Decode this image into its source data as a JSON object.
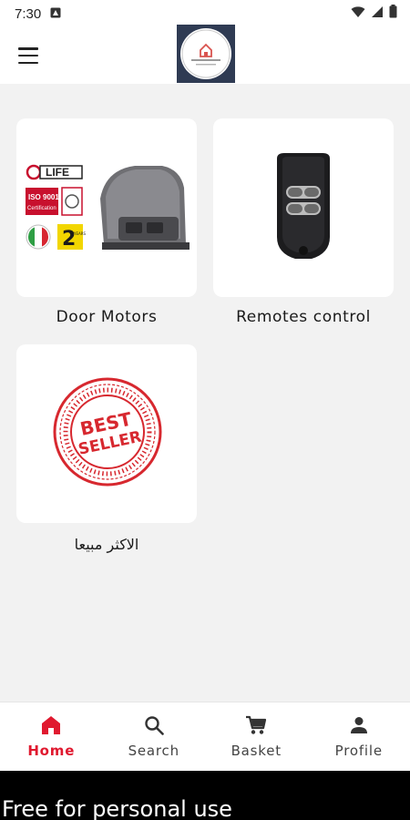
{
  "status_bar": {
    "time": "7:30"
  },
  "categories": [
    {
      "label": "Door Motors",
      "image": "door-motor-product-image"
    },
    {
      "label": "Remotes control",
      "image": "remote-control-product-image"
    },
    {
      "label": "الاكثر مبيعا",
      "image": "best-seller-stamp-image"
    }
  ],
  "images": {
    "door_motor": {
      "brand_text": "LIFE",
      "iso_text": "ISO 9001",
      "cert_text": "Certification",
      "warranty_years": "2",
      "warranty_text": "YEARS"
    },
    "best_seller": {
      "line1": "BEST",
      "line2": "SELLER"
    }
  },
  "bottom_nav": [
    {
      "label": "Home",
      "icon": "home-icon",
      "active": true
    },
    {
      "label": "Search",
      "icon": "search-icon",
      "active": false
    },
    {
      "label": "Basket",
      "icon": "cart-icon",
      "active": false
    },
    {
      "label": "Profile",
      "icon": "person-icon",
      "active": false
    }
  ],
  "footer_banner": {
    "text": "Free for personal use"
  },
  "colors": {
    "accent": "#e0192f",
    "background": "#f2f2f2",
    "card": "#ffffff",
    "logo_frame": "#2f3b53"
  }
}
